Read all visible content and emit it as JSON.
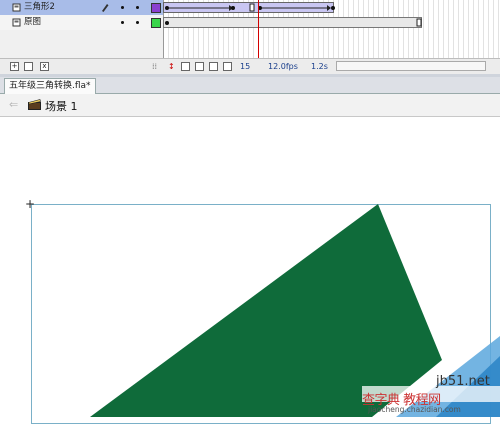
{
  "timeline": {
    "layers": [
      {
        "name": "三角形2",
        "color": "#8a3fd1",
        "selected": true
      },
      {
        "name": "原图",
        "color": "#3ad64b",
        "selected": false
      }
    ],
    "frame_number": "15",
    "fps": "12.0fps",
    "time": "1.2s"
  },
  "document": {
    "tab_title": "五年级三角转换.fla*"
  },
  "editbar": {
    "scene_label": "场景 1"
  },
  "stage": {
    "shape_color": "#0f6b3a",
    "frame_color": "#7ab0c8"
  },
  "watermark": {
    "line1": "jb51.net",
    "line2": "查字典 教程网",
    "line3": "jiaocheng.chazidian.com"
  },
  "icons": [
    "layer-icon",
    "pencil-icon",
    "eye-dot",
    "lock-dot",
    "new-layer-icon",
    "folder-icon",
    "trash-icon",
    "back-arrow-icon",
    "scene-clapper-icon"
  ]
}
